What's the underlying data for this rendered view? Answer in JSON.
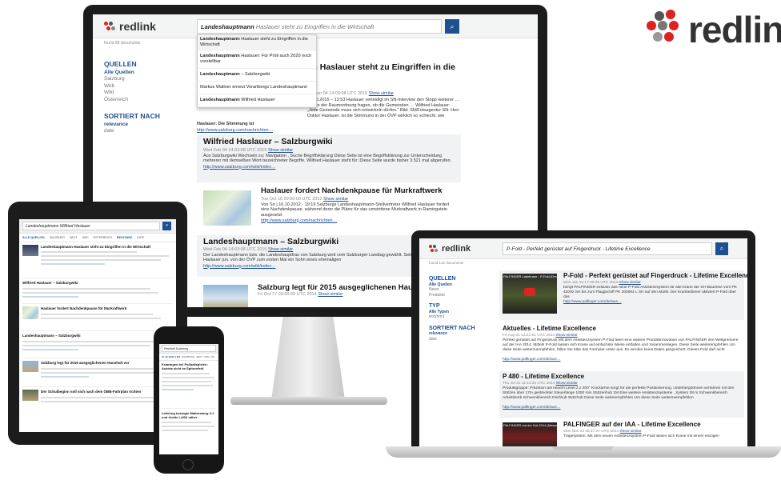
{
  "brand": {
    "logo": "redlink"
  },
  "desktop": {
    "query_bold": "Landeshauptmann",
    "query_rest": "Haslauer steht zu Eingriffen in die Wirtschaft",
    "found": "found 88 documents",
    "suggestions": [
      {
        "bold": "Landeshauptmann",
        "rest": "Haslauer steht zu Eingriffen in die Wirtschaft"
      },
      {
        "bold": "Landeshauptmann",
        "rest": "Haslauer: Für Pröll auch 2020 noch vorstellbar"
      },
      {
        "bold": "Landeshauptmann",
        "rest": "– Salzburgwiki"
      },
      {
        "bold": "",
        "rest": "Markus Wallner erneut Vorarlbergs Landeshauptmann"
      },
      {
        "bold": "Landeshauptmann",
        "rest": "Wilfried Haslauer"
      }
    ],
    "sidebar": {
      "sources_title": "QUELLEN",
      "sources": [
        "Alle Quellen",
        "Salzburg",
        "Web",
        "Wiki",
        "Österreich"
      ],
      "sort_title": "SORTIERT NACH",
      "sort": [
        "relevance",
        "date"
      ]
    },
    "results": [
      {
        "title": "Landeshauptmann Haslauer steht zu Eingriffen in die Wirtschaft",
        "title_visible": "nn Haslauer steht zu Eingriffen in die",
        "meta": "Mo Jun 04 14:03:08 UTC 2015",
        "similar": "Show similar",
        "snippet": "02.05.2015 – 12:53 Haslauer verteidigt im SN-Interview den Stopp weiterer … sich in der Raumordnung fragen, ob die Gemeinden … Wilfried Haslauer: „Jede Gemeinde muss sich entwickeln dürfen.\" Bild: SN/Fotoagentur SN: Herr Doktor Haslauer, ist die Stimmung in der ÖVP wirklich so schlecht, wie manche sagen?",
        "snippet2": "Haslauer: Die Stimmung ist",
        "url": "http://www.salzburg.com/nachrichten…"
      },
      {
        "title": "Wilfried Haslauer – Salzburgwiki",
        "meta": "Wed Feb 04 14:03:08 UTC 2015",
        "similar": "Show similar",
        "snippet": "Aus Salzburgwiki Wechseln zu: Navigation , Suche Begriffsklärung Diese Seite ist eine Begriffsklärung zur Unterscheidung mehrerer mit demselben Wort bezeichneter Begriffe. Wilfried Haslauer steht für: Diese Seite wurde bisher 3.521 mal abgerufen.",
        "url": "http://www.salzburg.com/wiki/index…"
      },
      {
        "title": "Haslauer fordert Nachdenkpause für Murkraftwerk",
        "meta": "Tue Oct 16 00:00:00 UTC 2012",
        "similar": "Show similar",
        "snippet": "Von Sn | 16.10.2012 - 19:19 Salzburgs Landeshauptmann-Stellvertreter Wilfried Haslauer fordert eine Nachdenkpause, während derer die Pläne für das umstrittene Murkraftwerk in Ramingstein ausgesetzt",
        "url": "http://www.salzburg.com/nachrichten…"
      },
      {
        "title": "Landeshauptmann – Salzburgwiki",
        "meta": "Wed Feb 04 14:03:08 UTC 2015",
        "similar": "Show similar",
        "snippet": "Der Landeshauptmann bzw. die Landeshauptfrau von Salzburg wird vom Salzburger Landtag gewählt. Seit 2013 bekleidet mit Haslauer jun. von der ÖVP zum ersten Mal ein Sohn eines ehemaligen",
        "url": "http://www.salzburg.com/wiki/index…"
      },
      {
        "title": "Salzburg legt für 2015 ausgeglichenen Haushalt vo",
        "meta": "Fri Oct 17 00:00:00 UTC 2014",
        "similar": "Show similar",
        "snippet": "",
        "url": ""
      }
    ]
  },
  "laptop": {
    "query": "P-Fold - Perfekt gerüstet auf Fingerdruck - Lifetime Excellence",
    "found": "found 132 documents",
    "sidebar": {
      "sources_title": "QUELLEN",
      "sources": [
        "Alle Quellen",
        "News",
        "Produkte"
      ],
      "type_title": "TYP",
      "types": [
        "Alle Typen",
        "text/html"
      ],
      "sort_title": "SORTIERT NACH",
      "sort": [
        "relevance",
        "date"
      ]
    },
    "video_label": "PALFINGER Ladekrane - P-Fold (Deu…",
    "results": [
      {
        "title": "P-Fold - Perfekt gerüstet auf Fingerdruck - Lifetime Excellence",
        "meta": "Mon Jan 13 17:49:35 UTC 2014",
        "similar": "Show similar",
        "snippet": "bringt PALFINGER exklusiv das neue P-Fold Assistenzsystem für alle Krane der SH-Baureihe vom PK 42002 SH bis zum Flaggschiff PK 200002 L SH auf den Markt. Der Kranbediener aktiviert P-Fold über das",
        "url": "http://www.palfinger.com/de/aus…"
      },
      {
        "title": "Aktuelles - Lifetime Excellence",
        "meta": "Fri Aug 01 13:21:51 UTC 2014",
        "similar": "Show similar",
        "snippet": "Perfekt gerüstet auf Fingerdruck Mit dem Assistenzsystem P-Fold feiert eine weitere Produktinnovation von PALFINGER ihre Weltpremiere auf der IAA 2014. Mittels P-Fold lassen sich Krane auf einfachste Weise entfalten und zusammenlegen. Diese Seite weiterempfehlen Um diese Seite weiterzuempfehlen, füllen Sie bitte das Formular unten aus. Es werden keine Daten gespeichert. Dieses Feld darf nicht",
        "url": "http://www.palfinger.com/de/aus…"
      },
      {
        "title": "P 480 - Lifetime Excellence",
        "meta": "Thu Jul 31 11:41:34 UTC 2014",
        "similar": "Show similar",
        "snippet": "Produktgruppe: Präzision auf neuem Level 2 x 200° Knickarme sorgt für die perfekte Positionierung. Unterbergbühnen verfahren mit den Stützen über 17m gestreckter Steuerlänge 1000 mm Stützenhub 1M Eine weitere Assistenzsysteme . System 28 m Schwenkbereich Arbeitskorb Schwenkbereich Drehhub Stützhub Diese Seite weiterempfehlen Um diese Seite weiterzuempfehlen",
        "url": "http://www.palfinger.com/de/aus…"
      },
      {
        "title": "PALFINGER auf der IAA - Lifetime Excellence",
        "meta": "Mon Nov 03 16:27:37 UTC 2014",
        "similar": "Show similar",
        "snippet": "Tragesystem. Mit dem neuen Assistenzsystem P-Fold lassen sich Krane mit einem einzigen",
        "url": ""
      }
    ],
    "video2_label": "PALFINGER auf der IAA 2014 (Messeimp…"
  },
  "tablet": {
    "query": "Landeshauptmann Wilfried Haslauer",
    "tabs": [
      "ALLE QUELLEN",
      "SALZBURG",
      "WELT",
      "WIKI",
      "ÖSTERREICH",
      "RELEVANZ",
      "DATE"
    ],
    "results": [
      {
        "title": "Landeshauptmann Haslauer steht zu Eingriffen in die Wirtschaft"
      },
      {
        "title": "Wilfried Haslauer – Salzburgwiki"
      },
      {
        "title": "Haslauer fordert Nachdenkpause für Murkraftwerk"
      },
      {
        "title": "Landeshauptmann – Salzburgwiki"
      },
      {
        "title": "Salzburg legt für 2015 ausgeglichenen Haushalt vor"
      },
      {
        "title": "Der Schulbeginn soll sich nach dem ÖBB-Fahrplan richten"
      }
    ]
  },
  "phone": {
    "query": "Redbull Salzburg",
    "tabs": [
      "ALLE QUELLEN",
      "SALZBURG",
      "WELT",
      "WIKI",
      "ÖS"
    ],
    "results": [
      {
        "title": "Krawingen bei Fußballspielen: Austria sicht im Spitzenfeld"
      },
      {
        "title": "Liefering besiegte Mattersburg 3:1 und rückte LASK näher"
      }
    ]
  }
}
